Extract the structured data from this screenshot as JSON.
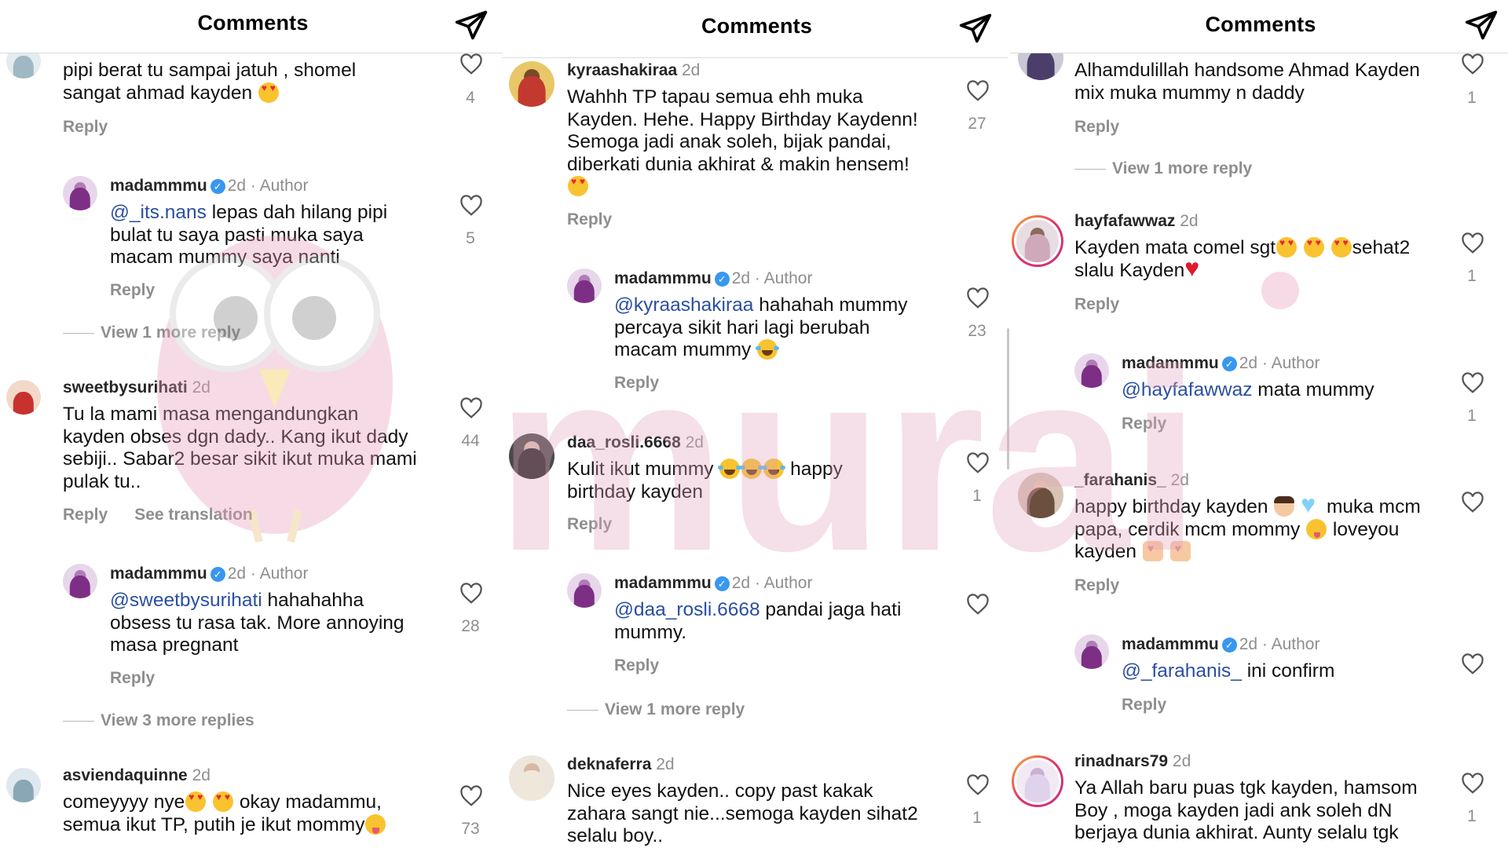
{
  "header": {
    "title": "Comments"
  },
  "colors": {
    "mention": "#2b4fa0",
    "verified": "#3897f0",
    "muted": "#8e8e8e"
  },
  "icons": {
    "send": "send-icon",
    "like": "heart-outline-icon",
    "verified": "verified-badge-icon"
  },
  "watermark": {
    "text": "murai"
  },
  "panel1": {
    "c1": {
      "text_a": "pipi berat tu sampai jatuh , shomel",
      "text_b": "sangat ahmad kayden",
      "reply": "Reply",
      "likes": "4"
    },
    "c2": {
      "user": "madammmu",
      "time": "2d",
      "author": "· Author",
      "mention": "@_its.nans",
      "text_a": " lepas dah hilang pipi",
      "text_b": "bulat tu saya pasti muka saya",
      "text_c": "macam mummy saya nanti",
      "reply": "Reply",
      "likes": "5"
    },
    "more1": "View 1 more reply",
    "c3": {
      "user": "sweetbysurihati",
      "time": "2d",
      "text_a": "Tu la mami masa mengandungkan",
      "text_b": "kayden obses dgn dady.. Kang ikut dady",
      "text_c": "sebiji.. Sabar2 besar sikit ikut muka mami",
      "text_d": "pulak tu..",
      "reply": "Reply",
      "translation": "See translation",
      "likes": "44"
    },
    "c4": {
      "user": "madammmu",
      "time": "2d",
      "author": "· Author",
      "mention": "@sweetbysurihati",
      "text_a": " hahahahha",
      "text_b": "obsess tu rasa tak. More annoying",
      "text_c": "masa pregnant",
      "reply": "Reply",
      "likes": "28"
    },
    "more2": "View 3 more replies",
    "c5": {
      "user": "asviendaquinne",
      "time": "2d",
      "text_a1": "comeyyyy nye",
      "text_a2": " okay madammu,",
      "text_b": "semua ikut TP, putih je ikut mommy",
      "likes": "73"
    }
  },
  "panel2": {
    "c1": {
      "user": "kyraashakiraa",
      "time": "2d",
      "text_a": "Wahhh TP tapau semua ehh muka",
      "text_b": "Kayden. Hehe. Happy Birthday Kaydenn!",
      "text_c": "Semoga jadi anak soleh, bijak pandai,",
      "text_d": "diberkati dunia akhirat & makin hensem!",
      "reply": "Reply",
      "likes": "27"
    },
    "c2": {
      "user": "madammmu",
      "time": "2d",
      "author": "· Author",
      "mention": "@kyraashakiraa",
      "text_a": " hahahah mummy",
      "text_b": "percaya sikit hari lagi berubah",
      "text_c": "macam mummy ",
      "reply": "Reply",
      "likes": "23"
    },
    "c3": {
      "user": "daa_rosli.6668",
      "time": "2d",
      "text_a1": "Kulit ikut mummy ",
      "text_a2": " happy",
      "text_b": "birthday kayden",
      "reply": "Reply",
      "likes": "1"
    },
    "c4": {
      "user": "madammmu",
      "time": "2d",
      "author": "· Author",
      "mention": "@daa_rosli.6668",
      "text_a": " pandai jaga hati",
      "text_b": "mummy.",
      "reply": "Reply"
    },
    "more1": "View 1 more reply",
    "c5": {
      "user": "deknaferra",
      "time": "2d",
      "text_a": "Nice eyes kayden.. copy past kakak",
      "text_b": "zahara sangt nie...semoga kayden sihat2",
      "text_c": "selalu boy..",
      "likes": "1"
    }
  },
  "panel3": {
    "c1": {
      "text_a": "Alhamdulillah handsome Ahmad Kayden",
      "text_b": "mix muka mummy n daddy",
      "reply": "Reply",
      "likes": "1"
    },
    "more1": "View 1 more reply",
    "c2": {
      "user": "hayfafawwaz",
      "time": "2d",
      "text_a1": "Kayden mata comel sgt",
      "text_a2": "sehat2",
      "text_b": "slalu Kayden",
      "reply": "Reply",
      "likes": "1"
    },
    "c3": {
      "user": "madammmu",
      "time": "2d",
      "author": "· Author",
      "mention": "@hayfafawwaz",
      "text_a": " mata mummy",
      "reply": "Reply",
      "likes": "1"
    },
    "c4": {
      "user": "_farahanis_",
      "time": "2d",
      "text_a1": "happy birthday kayden ",
      "text_a2": " muka mcm",
      "text_b1": "papa, cerdik mcm mommy ",
      "text_b2": " loveyou",
      "text_c": "kayden ",
      "reply": "Reply"
    },
    "c5": {
      "user": "madammmu",
      "time": "2d",
      "author": "· Author",
      "mention": "@_farahanis_",
      "text_a": " ini confirm",
      "reply": "Reply"
    },
    "c6": {
      "user": "rinadnars79",
      "time": "2d",
      "text_a": "Ya Allah baru puas tgk kayden, hamsom",
      "text_b": "Boy , moga kayden jadi ank soleh dN",
      "text_c": "berjaya dunia akhirat. Aunty selalu tgk",
      "likes": "1"
    }
  }
}
